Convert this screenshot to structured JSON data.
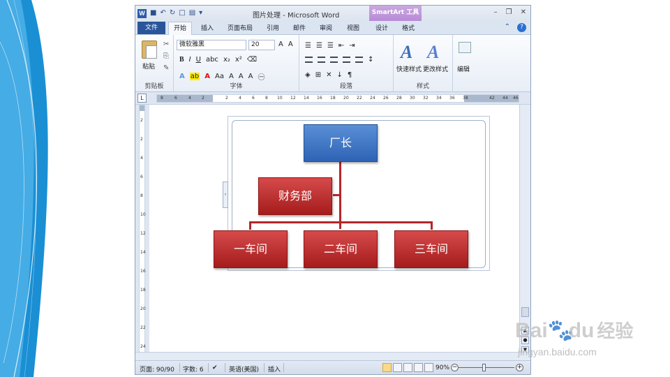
{
  "window": {
    "title": "图片处理 - Microsoft Word",
    "contextual_tab": "SmartArt 工具"
  },
  "tabs": {
    "file": "文件",
    "items": [
      "开始",
      "插入",
      "页面布局",
      "引用",
      "邮件",
      "审阅",
      "视图",
      "设计",
      "格式"
    ]
  },
  "ribbon": {
    "clipboard": {
      "paste": "粘贴",
      "label": "剪贴板"
    },
    "font": {
      "name": "微软雅黑",
      "size": "20",
      "label": "字体"
    },
    "paragraph": {
      "label": "段落"
    },
    "styles": {
      "quick": "快速样式",
      "change": "更改样式",
      "label": "样式"
    },
    "editing": {
      "label": "编辑"
    }
  },
  "ruler": {
    "ticks": [
      "8",
      "6",
      "4",
      "2",
      "2",
      "4",
      "6",
      "8",
      "10",
      "12",
      "14",
      "16",
      "18",
      "20",
      "22",
      "24",
      "26",
      "28",
      "30",
      "32",
      "34",
      "36",
      "38",
      "42",
      "44",
      "46"
    ],
    "vticks": [
      "2",
      "2",
      "4",
      "6",
      "8",
      "10",
      "12",
      "14",
      "16",
      "18",
      "20",
      "22",
      "24"
    ]
  },
  "smartart": {
    "top": "厂长",
    "assistant": "财务部",
    "children": [
      "一车间",
      "二车间",
      "三车间"
    ]
  },
  "status": {
    "page": "页面: 90/90",
    "words": "字数: 6",
    "language": "英语(美国)",
    "mode": "插入",
    "zoom": "90%"
  },
  "watermark": {
    "brand": "Bai",
    "brand2": "du",
    "brand3": "经验",
    "url": "jingyan.baidu.com"
  },
  "colors": {
    "blue_box": "#2e63b5",
    "red_box": "#a51c1c",
    "connector": "#b3262b",
    "file_tab": "#2a5699",
    "smartart_tab": "#b78ad6"
  }
}
